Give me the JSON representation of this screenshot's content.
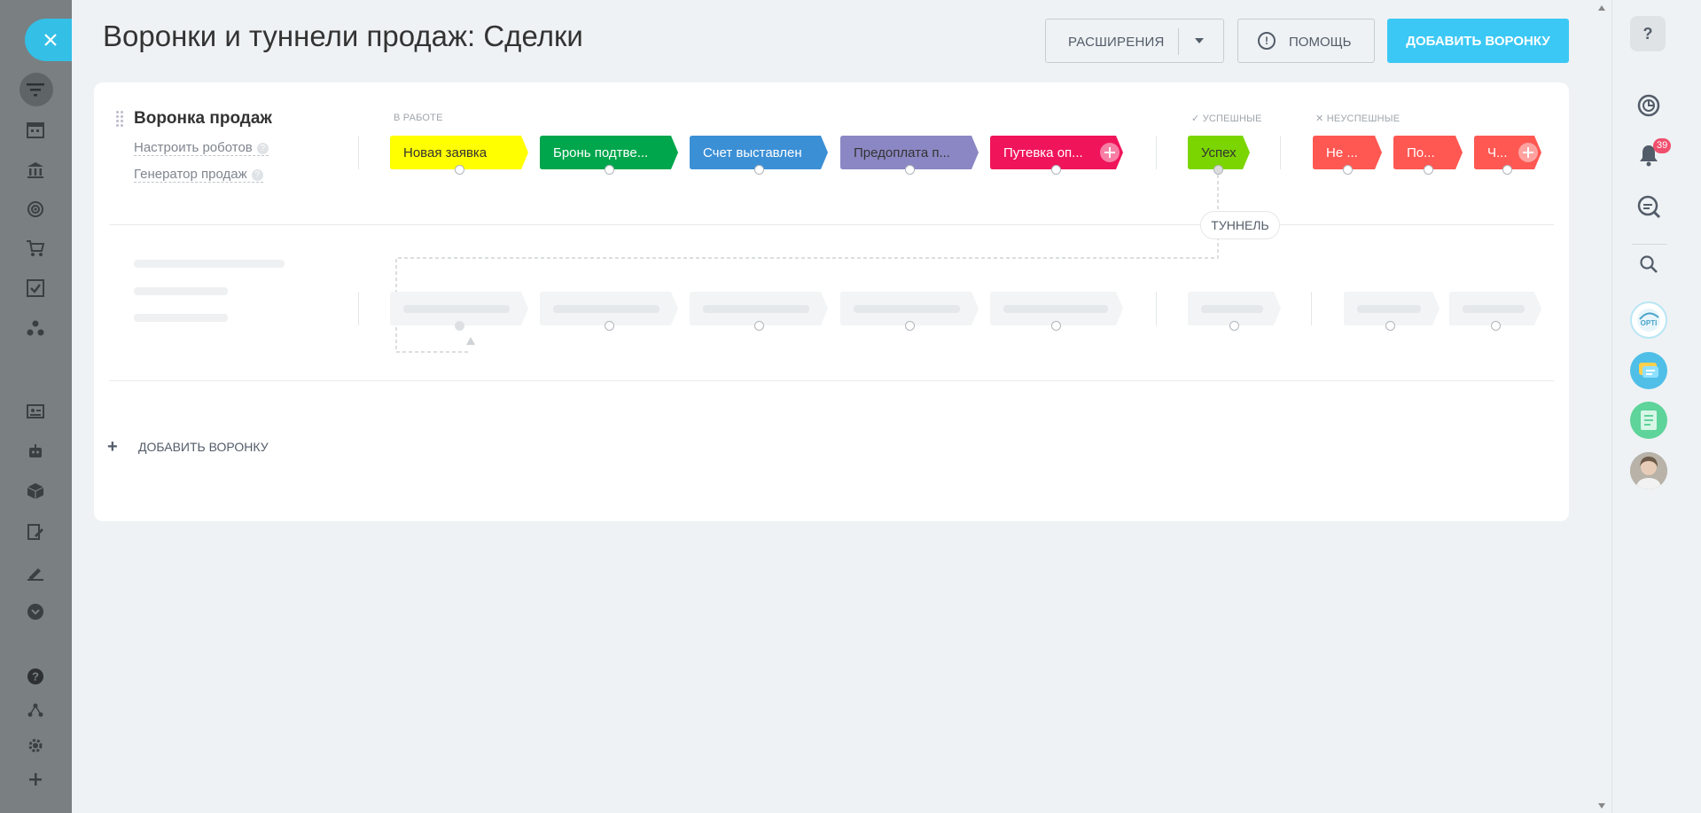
{
  "header": {
    "title": "Воронки и туннели продаж: Сделки",
    "extensions_label": "РАСШИРЕНИЯ",
    "help_label": "ПОМОЩЬ",
    "add_funnel_label": "ДОБАВИТЬ ВОРОНКУ"
  },
  "funnel": {
    "name": "Воронка продаж",
    "robots_link": "Настроить роботов",
    "generator_link": "Генератор продаж",
    "groups": {
      "in_work": "В РАБОТЕ",
      "success": "УСПЕШНЫЕ",
      "failed": "НЕУСПЕШНЫЕ"
    },
    "stages_in_work": [
      {
        "label": "Новая заявка",
        "color": "#ffff00",
        "text_color": "#333333"
      },
      {
        "label": "Бронь подтве...",
        "color": "#00a64c",
        "text_color": "#ffffff"
      },
      {
        "label": "Счет выставлен",
        "color": "#3b8fd5",
        "text_color": "#ffffff"
      },
      {
        "label": "Предоплата п...",
        "color": "#8b87c4",
        "text_color": "#333333"
      },
      {
        "label": "Путевка оп...",
        "color": "#f0145a",
        "text_color": "#ffffff"
      }
    ],
    "stage_success": {
      "label": "Успех",
      "color": "#7bd500",
      "text_color": "#333333"
    },
    "stages_failed": [
      {
        "label": "Не ...",
        "color": "#ff5752",
        "text_color": "#ffffff"
      },
      {
        "label": "По...",
        "color": "#ff5752",
        "text_color": "#ffffff"
      },
      {
        "label": "Ч...",
        "color": "#ff5752",
        "text_color": "#ffffff"
      }
    ],
    "tunnel_label": "ТУННЕЛЬ"
  },
  "footer": {
    "add_funnel_label": "ДОБАВИТЬ ВОРОНКУ"
  },
  "notifications": {
    "count": "39"
  },
  "icons": {
    "left_sidebar": [
      "filter-icon",
      "calendar-icon",
      "bank-icon",
      "target-icon",
      "cart-icon",
      "checklist-icon",
      "network-icon",
      "contact-card-icon",
      "robot-icon",
      "box-icon",
      "edit-doc-icon",
      "sign-icon",
      "chevron-down-icon",
      "help-icon",
      "sitemap-icon",
      "gear-icon",
      "plus-icon"
    ],
    "right_sidebar": [
      "help-icon",
      "timeline-icon",
      "bell-icon",
      "chat-search-icon",
      "search-icon",
      "opti-avatar",
      "chat-avatar",
      "notes-avatar",
      "user-avatar"
    ]
  }
}
